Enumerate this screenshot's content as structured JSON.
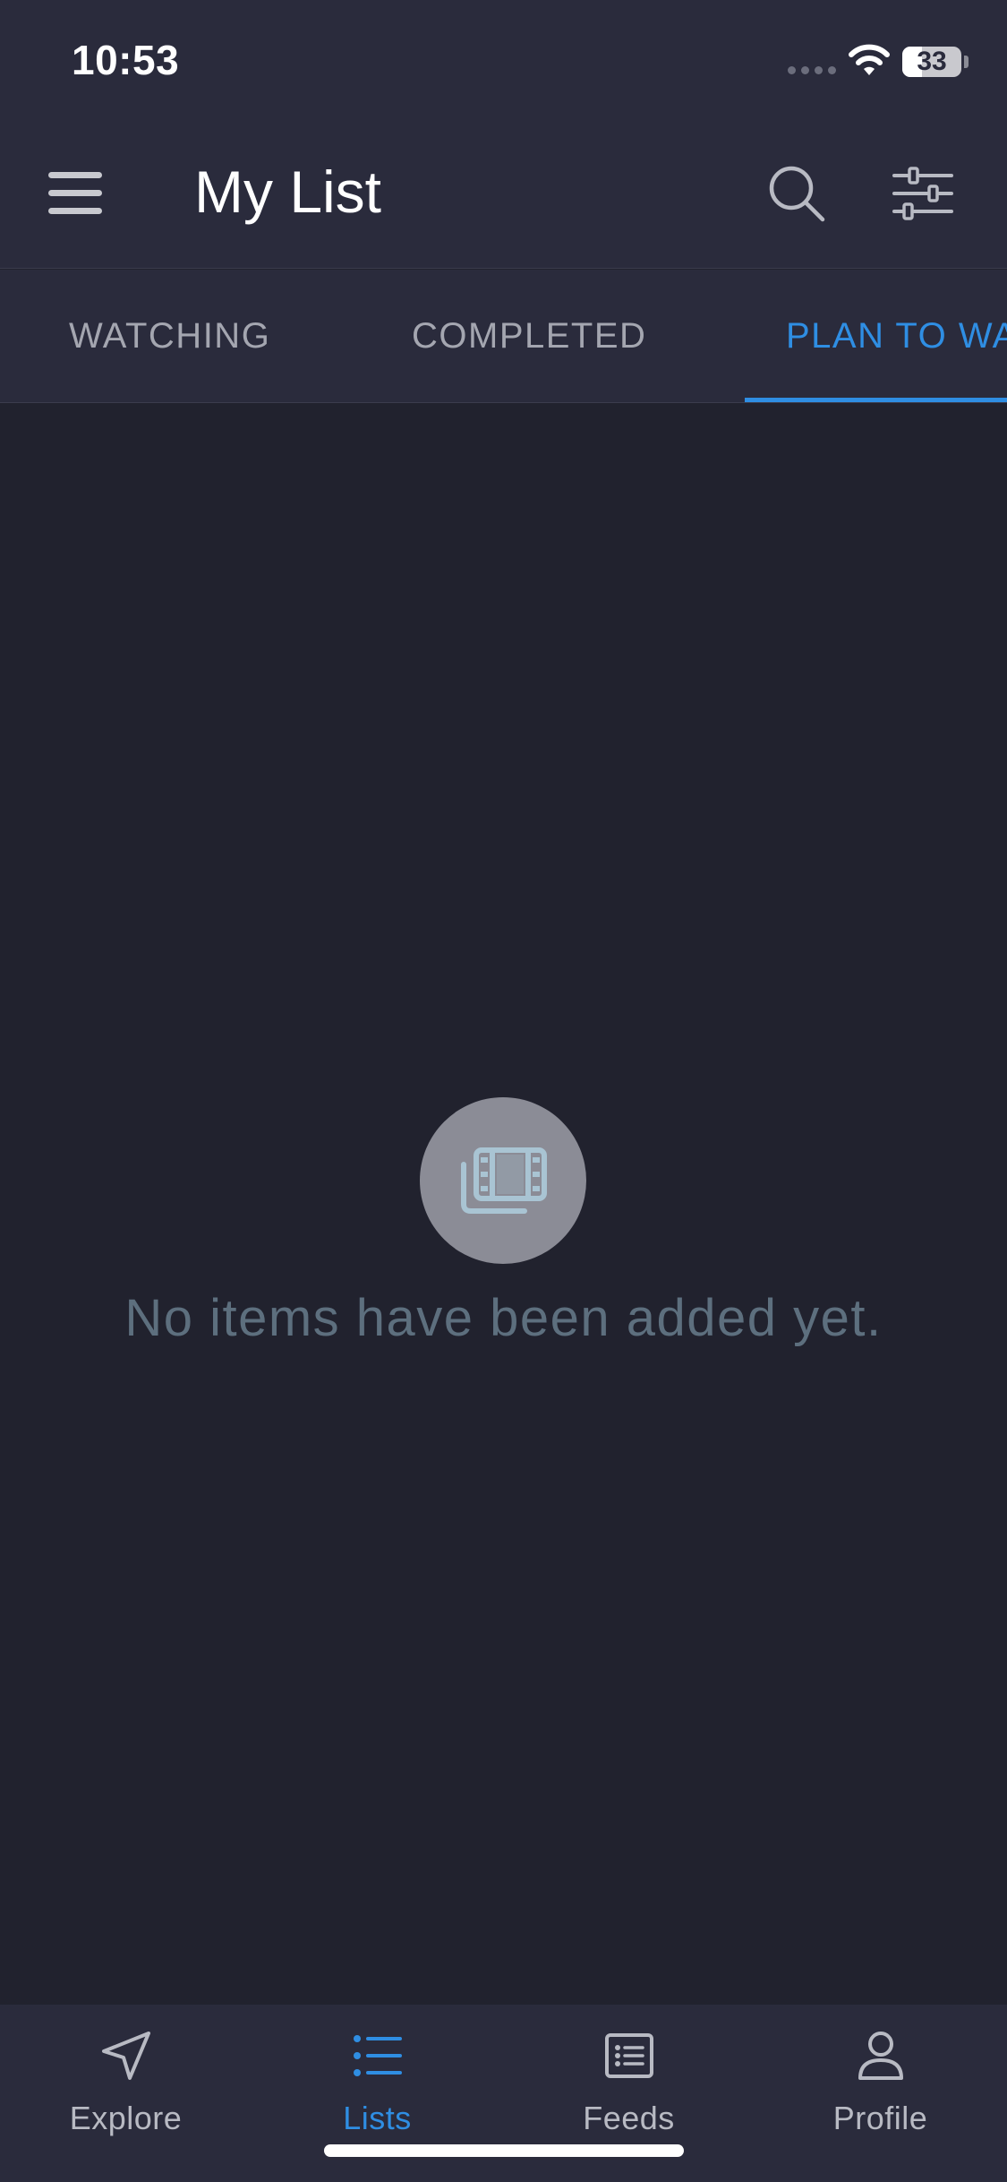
{
  "status_bar": {
    "time": "10:53",
    "battery_percent": 33,
    "battery_label": "33",
    "icons": [
      "cellular-dots-icon",
      "wifi-icon",
      "battery-icon"
    ]
  },
  "header": {
    "title": "My List",
    "icons": [
      "menu-icon",
      "search-icon",
      "filter-sliders-icon"
    ]
  },
  "tabs": [
    {
      "label": "WATCHING",
      "active": false
    },
    {
      "label": "COMPLETED",
      "active": false
    },
    {
      "label": "PLAN TO WATCH",
      "active": true
    }
  ],
  "empty_state": {
    "icon": "film-library-icon",
    "message": "No items have been added yet."
  },
  "bottom_nav": {
    "items": [
      {
        "label": "Explore",
        "icon": "navigation-arrow-icon",
        "active": false
      },
      {
        "label": "Lists",
        "icon": "list-icon",
        "active": true
      },
      {
        "label": "Feeds",
        "icon": "feed-icon",
        "active": false
      },
      {
        "label": "Profile",
        "icon": "person-icon",
        "active": false
      }
    ]
  },
  "colors": {
    "background": "#21222e",
    "bar_background": "#2a2b3c",
    "accent": "#2f8ee3",
    "inactive_text": "#a4a6b0",
    "empty_text": "#5d6f7e"
  }
}
